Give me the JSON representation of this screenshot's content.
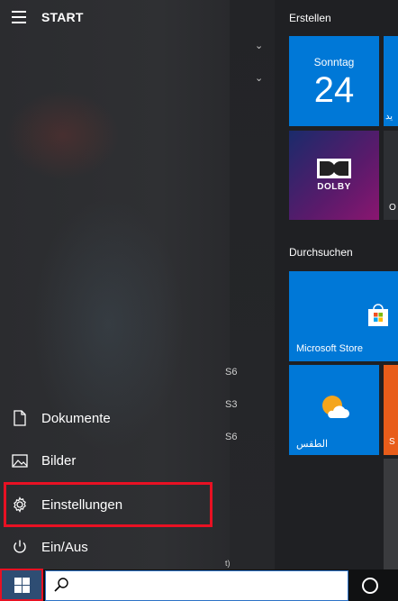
{
  "header": {
    "title": "START"
  },
  "applist": {
    "peek": [
      "S6",
      "S3",
      "S6",
      "t)"
    ]
  },
  "rail": {
    "items": [
      {
        "label": "Dokumente",
        "icon": "document-icon"
      },
      {
        "label": "Bilder",
        "icon": "pictures-icon"
      },
      {
        "label": "Einstellungen",
        "icon": "gear-icon"
      },
      {
        "label": "Ein/Aus",
        "icon": "power-icon"
      }
    ]
  },
  "tiles": {
    "group1_label": "Erstellen",
    "calendar": {
      "day": "Sonntag",
      "date": "24"
    },
    "cal_edge_text": "يد",
    "dolby": {
      "label": "DOLBY"
    },
    "edge2_text": "O",
    "group2_label": "Durchsuchen",
    "store": {
      "label": "Microsoft Store"
    },
    "weather": {
      "label": "الطقس"
    },
    "edge3_text": "S"
  },
  "colors": {
    "accent": "#0078d7",
    "highlight": "#e81123"
  }
}
